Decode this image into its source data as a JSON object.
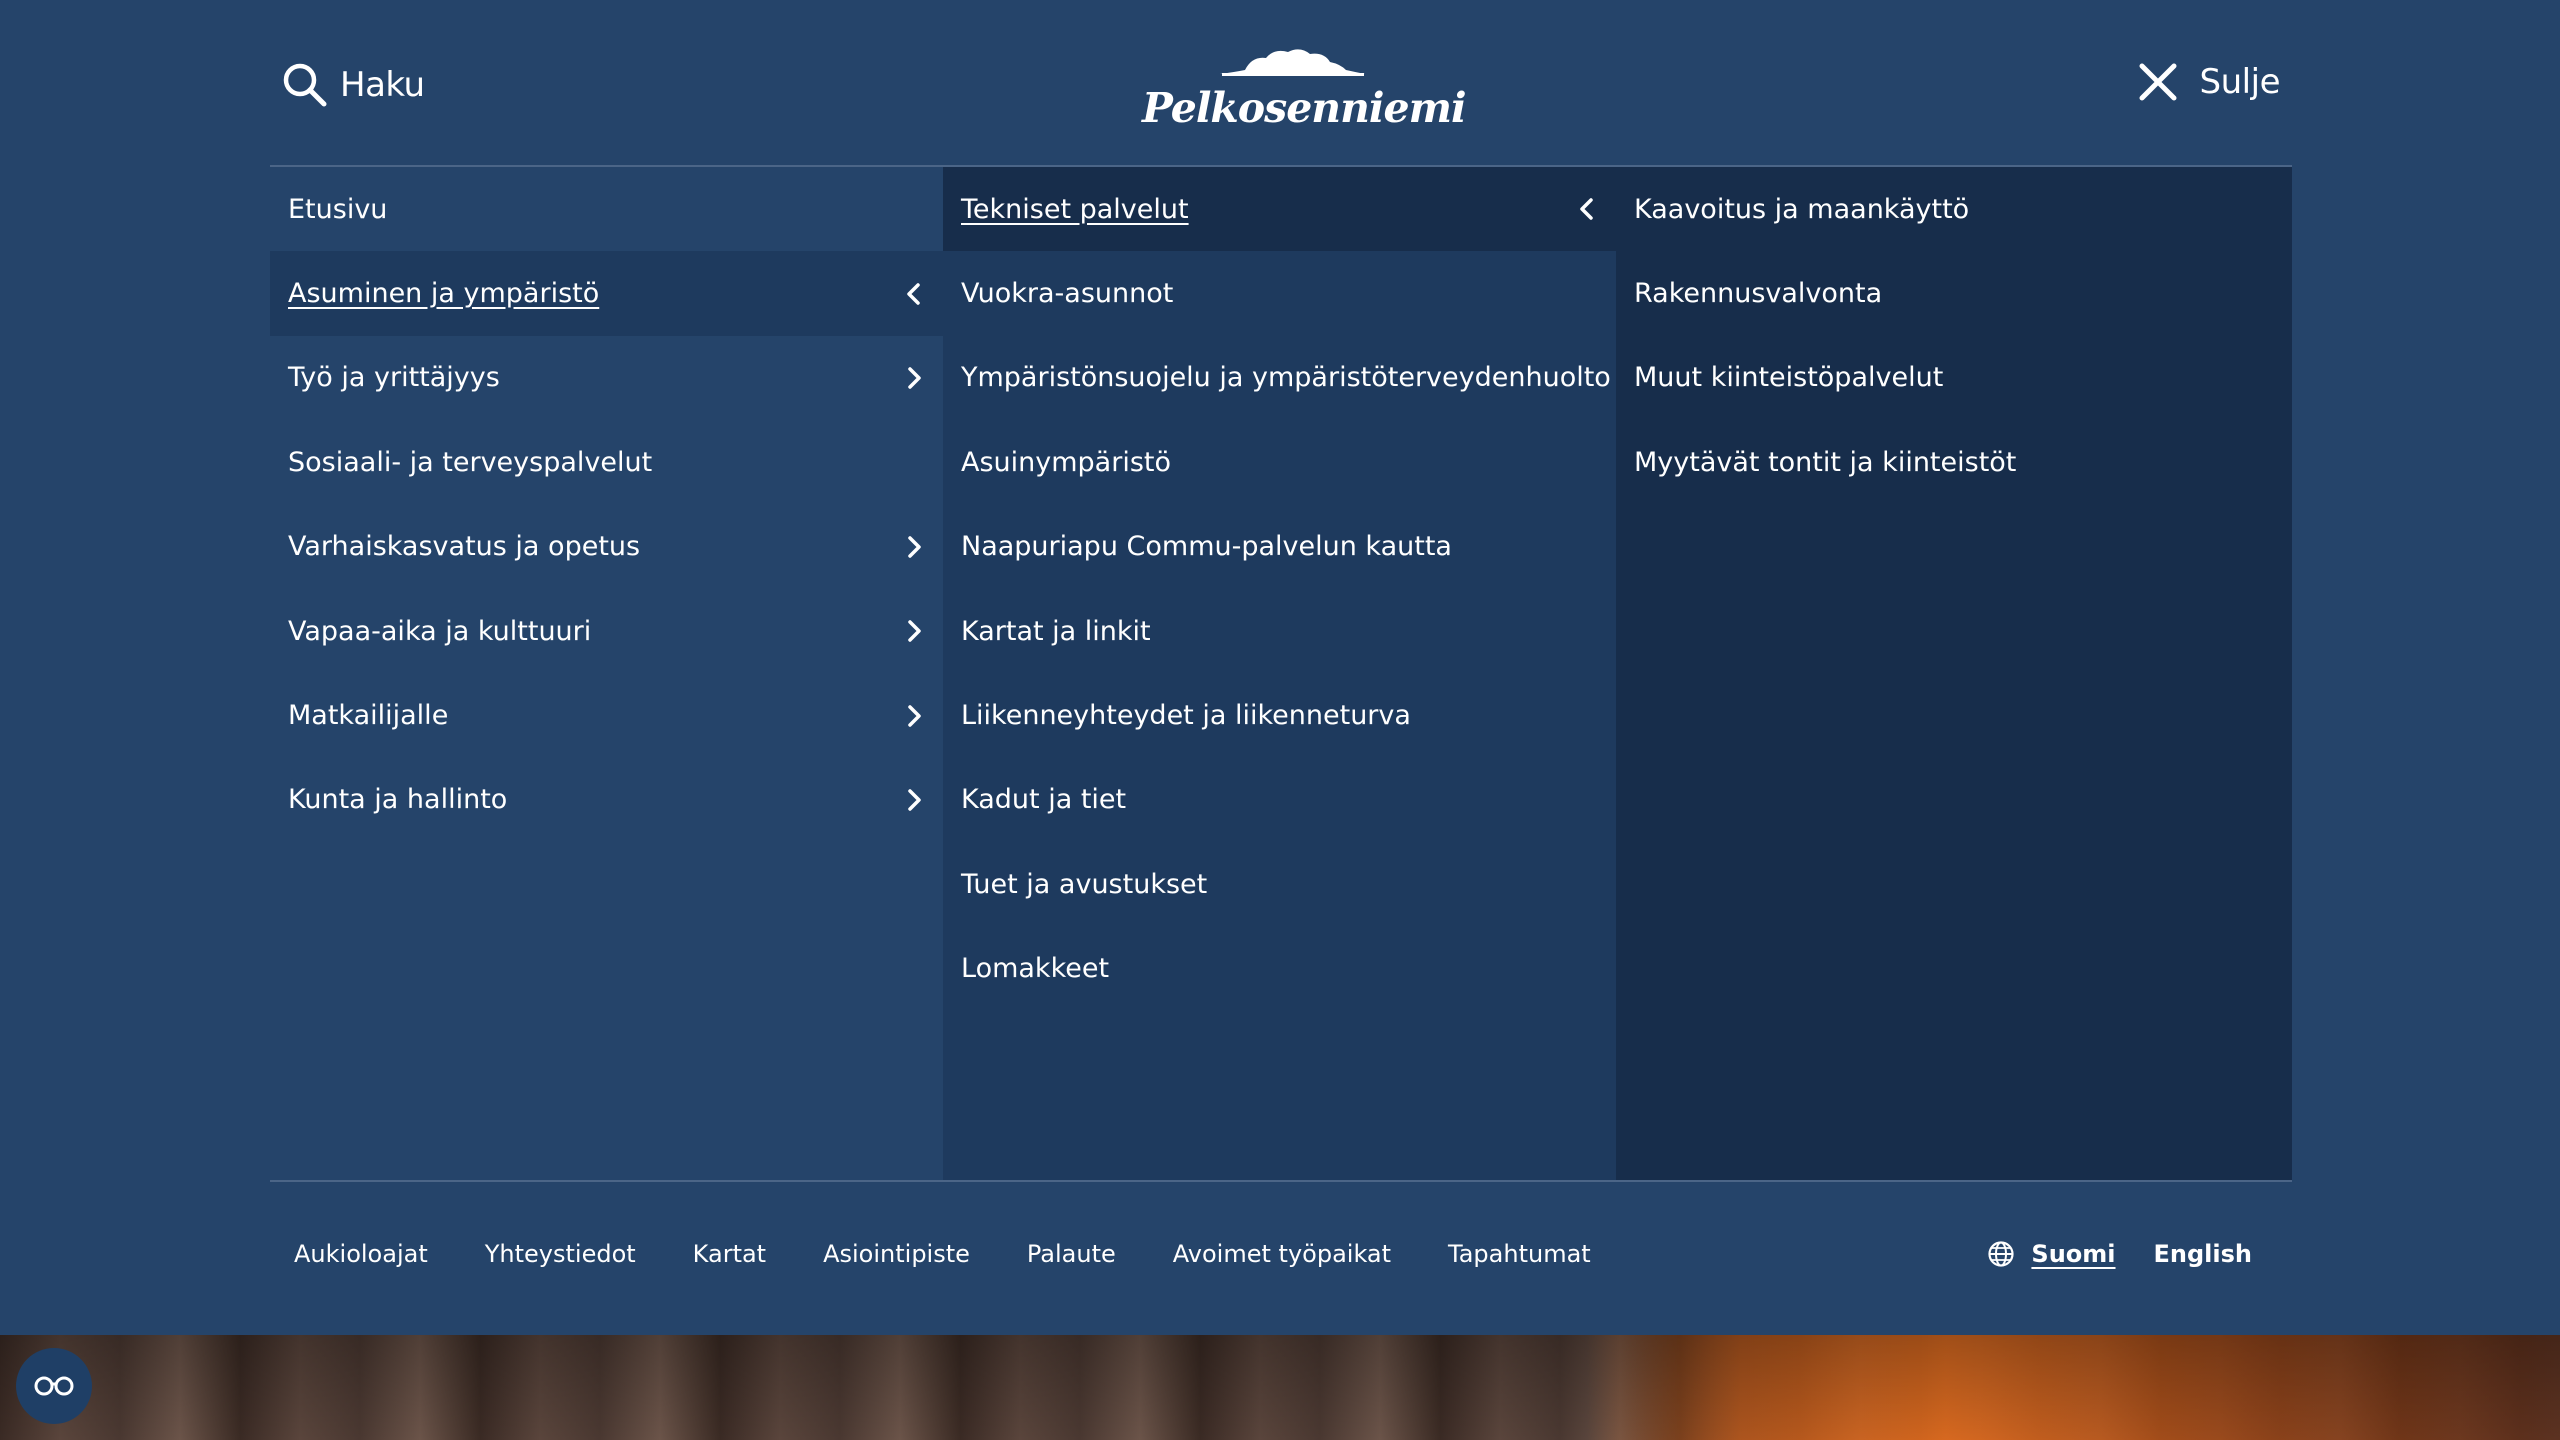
{
  "header": {
    "search_label": "Haku",
    "logo_text": "Pelkosenniemi",
    "close_label": "Sulje"
  },
  "menu": {
    "level1": [
      {
        "label": "Etusivu",
        "chevron": "none",
        "active": false
      },
      {
        "label": "Asuminen ja ympäristö",
        "chevron": "left",
        "active": true
      },
      {
        "label": "Työ ja yrittäjyys",
        "chevron": "right",
        "active": false
      },
      {
        "label": "Sosiaali- ja terveyspalvelut",
        "chevron": "none",
        "active": false
      },
      {
        "label": "Varhaiskasvatus ja opetus",
        "chevron": "right",
        "active": false
      },
      {
        "label": "Vapaa-aika ja kulttuuri",
        "chevron": "right",
        "active": false
      },
      {
        "label": "Matkailijalle",
        "chevron": "right",
        "active": false
      },
      {
        "label": "Kunta ja hallinto",
        "chevron": "right",
        "active": false
      }
    ],
    "level2": [
      {
        "label": "Tekniset palvelut",
        "chevron": "left",
        "active": true
      },
      {
        "label": "Vuokra-asunnot",
        "chevron": "none",
        "active": false
      },
      {
        "label": "Ympäristönsuojelu ja ympäristöterveydenhuolto",
        "chevron": "none",
        "active": false
      },
      {
        "label": "Asuinympäristö",
        "chevron": "none",
        "active": false
      },
      {
        "label": "Naapuriapu Commu-palvelun kautta",
        "chevron": "none",
        "active": false
      },
      {
        "label": "Kartat ja linkit",
        "chevron": "none",
        "active": false
      },
      {
        "label": "Liikenneyhteydet ja liikenneturva",
        "chevron": "none",
        "active": false
      },
      {
        "label": "Kadut ja tiet",
        "chevron": "none",
        "active": false
      },
      {
        "label": "Tuet ja avustukset",
        "chevron": "none",
        "active": false
      },
      {
        "label": "Lomakkeet",
        "chevron": "none",
        "active": false
      }
    ],
    "level3": [
      {
        "label": "Kaavoitus ja maankäyttö"
      },
      {
        "label": "Rakennusvalvonta"
      },
      {
        "label": "Muut kiinteistöpalvelut"
      },
      {
        "label": "Myytävät tontit ja kiinteistöt"
      }
    ]
  },
  "footer": {
    "links": [
      "Aukioloajat",
      "Yhteystiedot",
      "Kartat",
      "Asiointipiste",
      "Palaute",
      "Avoimet työpaikat",
      "Tapahtumat"
    ],
    "languages": {
      "current": "Suomi",
      "other": "English"
    }
  },
  "icons": {
    "search": "search-icon",
    "close": "close-icon",
    "globe": "globe-icon",
    "accessibility": "accessibility-glasses-icon",
    "chevron_left": "chevron-left-icon",
    "chevron_right": "chevron-right-icon"
  },
  "colors": {
    "panel": "#25446a",
    "panel_level2": "#1e3a5e",
    "panel_level3": "#172d4b",
    "text": "#ffffff"
  }
}
